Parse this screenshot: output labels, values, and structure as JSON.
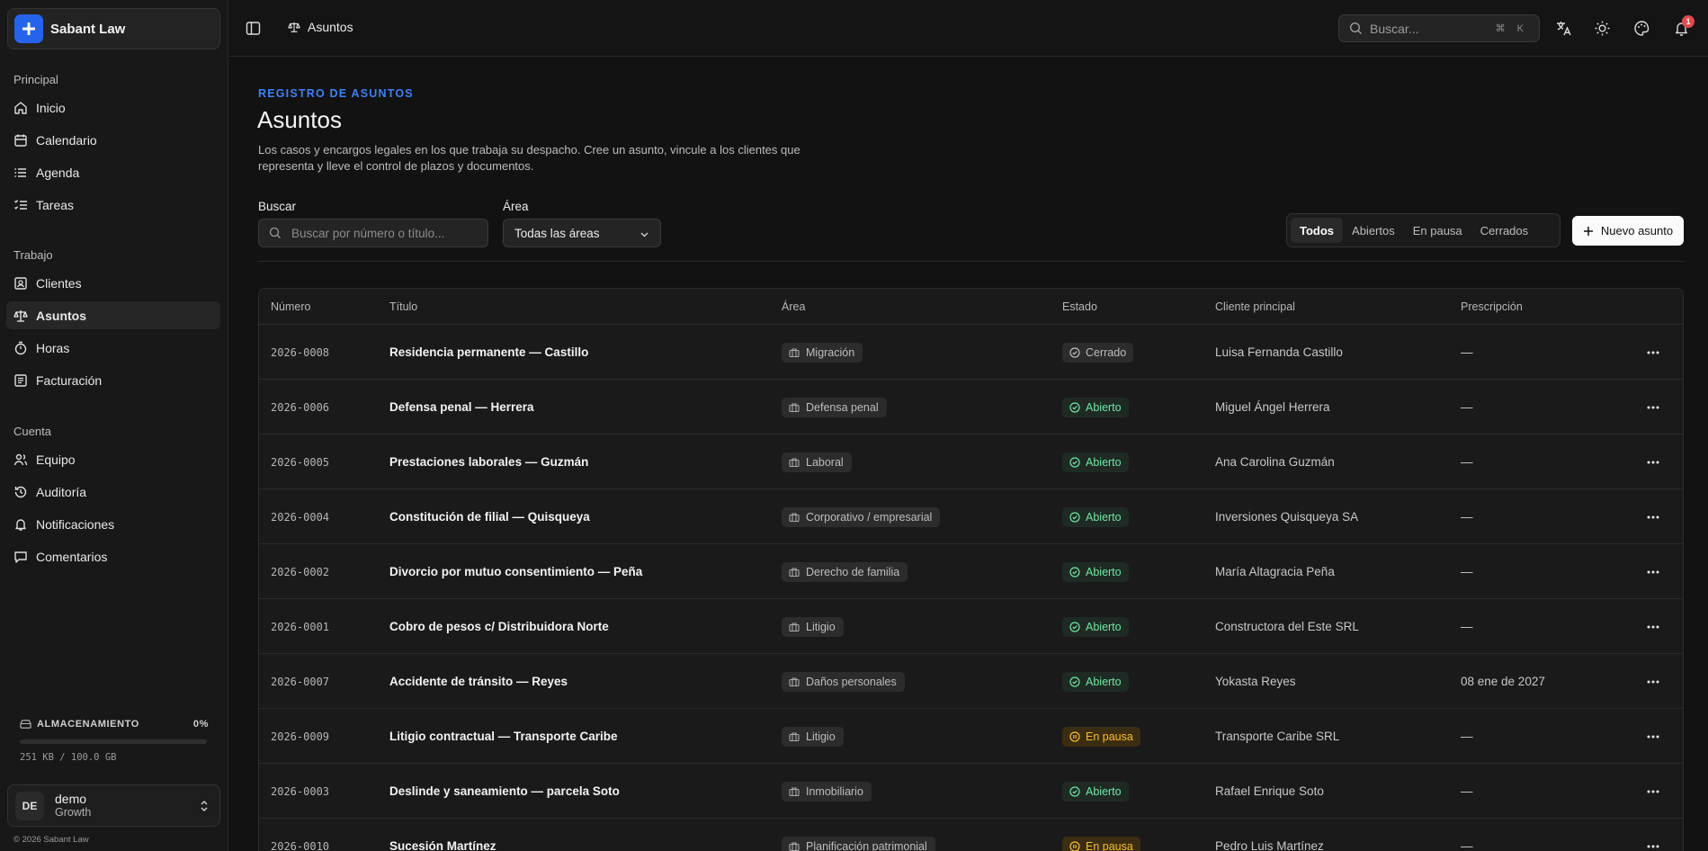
{
  "brand": {
    "name": "Sabant Law"
  },
  "sidebar": {
    "groups": [
      {
        "label": "Principal",
        "items": [
          {
            "label": "Inicio",
            "icon": "home-icon"
          },
          {
            "label": "Calendario",
            "icon": "calendar-icon"
          },
          {
            "label": "Agenda",
            "icon": "list-icon"
          },
          {
            "label": "Tareas",
            "icon": "tasks-icon"
          }
        ]
      },
      {
        "label": "Trabajo",
        "items": [
          {
            "label": "Clientes",
            "icon": "contact-icon"
          },
          {
            "label": "Asuntos",
            "icon": "scale-icon",
            "active": true
          },
          {
            "label": "Horas",
            "icon": "stopwatch-icon"
          },
          {
            "label": "Facturación",
            "icon": "receipt-icon"
          }
        ]
      },
      {
        "label": "Cuenta",
        "items": [
          {
            "label": "Equipo",
            "icon": "users-icon"
          },
          {
            "label": "Auditoría",
            "icon": "history-icon"
          },
          {
            "label": "Notificaciones",
            "icon": "bell-icon"
          },
          {
            "label": "Comentarios",
            "icon": "message-icon"
          }
        ]
      }
    ],
    "storage": {
      "label": "ALMACENAMIENTO",
      "percent_text": "0%",
      "percent": 0,
      "usage": "251 KB / 100.0 GB"
    },
    "user": {
      "initials": "DE",
      "name": "demo",
      "plan": "Growth"
    },
    "copyright": "© 2026 Sabant Law"
  },
  "topbar": {
    "breadcrumb": "Asuntos",
    "search_placeholder": "Buscar...",
    "shortcut": "⌘ K",
    "notification_count": "1"
  },
  "header": {
    "eyebrow": "REGISTRO DE ASUNTOS",
    "title": "Asuntos",
    "description": "Los casos y encargos legales en los que trabaja su despacho. Cree un asunto, vincule a los clientes que representa y lleve el control de plazos y documentos."
  },
  "filters": {
    "search_label": "Buscar",
    "search_placeholder": "Buscar por número o título...",
    "area_label": "Área",
    "area_value": "Todas las áreas",
    "status_tabs": [
      "Todos",
      "Abiertos",
      "En pausa",
      "Cerrados"
    ],
    "active_tab": "Todos",
    "new_button": "Nuevo asunto"
  },
  "table": {
    "columns": [
      "Número",
      "Título",
      "Área",
      "Estado",
      "Cliente principal",
      "Prescripción"
    ],
    "rows": [
      {
        "number": "2026-0008",
        "title": "Residencia permanente — Castillo",
        "area": "Migración",
        "status": "Cerrado",
        "client": "Luisa Fernanda Castillo",
        "prescription": "—"
      },
      {
        "number": "2026-0006",
        "title": "Defensa penal — Herrera",
        "area": "Defensa penal",
        "status": "Abierto",
        "client": "Miguel Ángel Herrera",
        "prescription": "—"
      },
      {
        "number": "2026-0005",
        "title": "Prestaciones laborales — Guzmán",
        "area": "Laboral",
        "status": "Abierto",
        "client": "Ana Carolina Guzmán",
        "prescription": "—"
      },
      {
        "number": "2026-0004",
        "title": "Constitución de filial — Quisqueya",
        "area": "Corporativo / empresarial",
        "status": "Abierto",
        "client": "Inversiones Quisqueya SA",
        "prescription": "—"
      },
      {
        "number": "2026-0002",
        "title": "Divorcio por mutuo consentimiento — Peña",
        "area": "Derecho de familia",
        "status": "Abierto",
        "client": "María Altagracia Peña",
        "prescription": "—"
      },
      {
        "number": "2026-0001",
        "title": "Cobro de pesos c/ Distribuidora Norte",
        "area": "Litigio",
        "status": "Abierto",
        "client": "Constructora del Este SRL",
        "prescription": "—"
      },
      {
        "number": "2026-0007",
        "title": "Accidente de tránsito — Reyes",
        "area": "Daños personales",
        "status": "Abierto",
        "client": "Yokasta Reyes",
        "prescription": "08 ene de 2027"
      },
      {
        "number": "2026-0009",
        "title": "Litigio contractual — Transporte Caribe",
        "area": "Litigio",
        "status": "En pausa",
        "client": "Transporte Caribe SRL",
        "prescription": "—"
      },
      {
        "number": "2026-0003",
        "title": "Deslinde y saneamiento — parcela Soto",
        "area": "Inmobiliario",
        "status": "Abierto",
        "client": "Rafael Enrique Soto",
        "prescription": "—"
      },
      {
        "number": "2026-0010",
        "title": "Sucesión Martínez",
        "area": "Planificación patrimonial",
        "status": "En pausa",
        "client": "Pedro Luis Martínez",
        "prescription": "—"
      }
    ]
  },
  "colors": {
    "accent": "#2563eb",
    "open": "#6ee7a3",
    "paused": "#fbbf24",
    "closed": "#bdbdbd"
  }
}
